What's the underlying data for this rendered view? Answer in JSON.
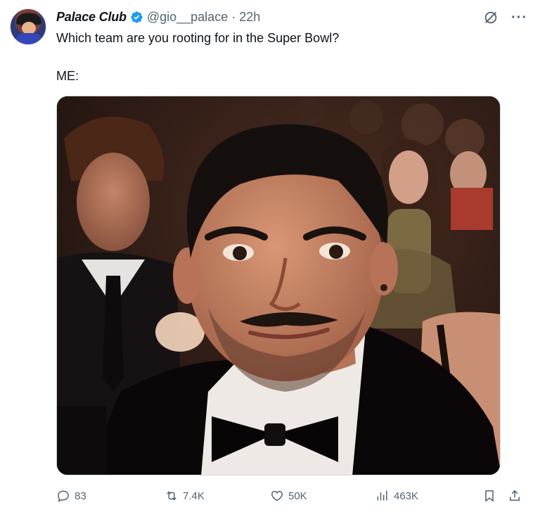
{
  "tweet": {
    "author_name": "Palace Club",
    "handle": "@gio__palace",
    "separator": "·",
    "time": "22h",
    "text": "Which team are you rooting for in the Super Bowl?",
    "text_line2": "ME:",
    "verified_color": "#1d9bf0",
    "avatar_icon": "profile-avatar",
    "media_description_icon": "photo"
  },
  "actions": {
    "replies": "83",
    "retweets": "7.4K",
    "likes": "50K",
    "views": "463K"
  },
  "colors": {
    "text": "#0f1419",
    "muted": "#536471",
    "accent": "#1d9bf0"
  }
}
